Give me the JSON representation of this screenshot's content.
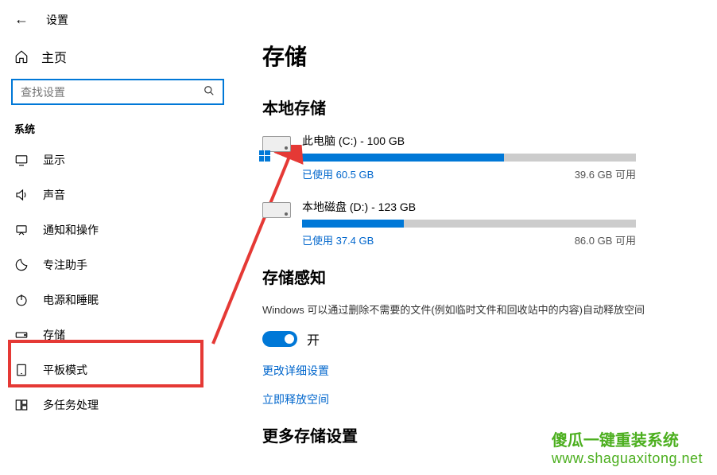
{
  "header": {
    "back": "←",
    "settings": "设置"
  },
  "home": {
    "label": "主页"
  },
  "search": {
    "placeholder": "查找设置"
  },
  "section": "系统",
  "nav": [
    {
      "label": "显示"
    },
    {
      "label": "声音"
    },
    {
      "label": "通知和操作"
    },
    {
      "label": "专注助手"
    },
    {
      "label": "电源和睡眠"
    },
    {
      "label": "存储"
    },
    {
      "label": "平板模式"
    },
    {
      "label": "多任务处理"
    }
  ],
  "page": {
    "title": "存储"
  },
  "local": {
    "heading": "本地存储",
    "drives": [
      {
        "name": "此电脑 (C:) - 100 GB",
        "used": "已使用 60.5 GB",
        "free": "39.6 GB 可用",
        "pct": 60.5,
        "isSystem": true
      },
      {
        "name": "本地磁盘 (D:) - 123 GB",
        "used": "已使用 37.4 GB",
        "free": "86.0 GB 可用",
        "pct": 30.4,
        "isSystem": false
      }
    ]
  },
  "sense": {
    "heading": "存储感知",
    "desc": "Windows 可以通过删除不需要的文件(例如临时文件和回收站中的内容)自动释放空间",
    "toggleLabel": "开",
    "linkDetail": "更改详细设置",
    "linkFree": "立即释放空间"
  },
  "more": {
    "heading": "更多存储设置"
  },
  "watermark": {
    "l1": "傻瓜一键重装系统",
    "l2": "www.shaguaxitong.net"
  }
}
